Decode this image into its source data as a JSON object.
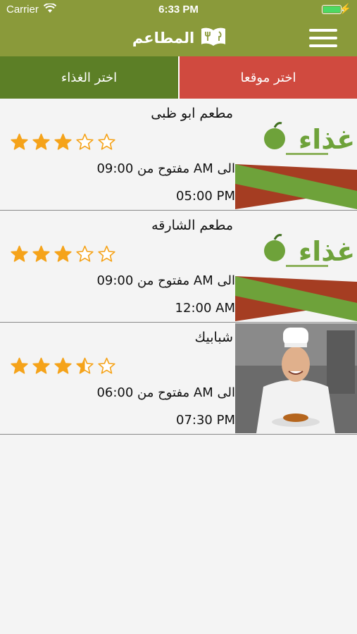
{
  "status_bar": {
    "carrier": "Carrier",
    "time": "6:33 PM"
  },
  "nav": {
    "title": "المطاعم"
  },
  "tabs": {
    "location": "اختر موقعا",
    "food": "اختر الغذاء"
  },
  "restaurants": [
    {
      "name": "مطعم ابو ظبى",
      "rating": 3,
      "hours_line1": "مفتوح من 09:00 AM الى",
      "hours_line2": "05:00 PM",
      "logo_text": "غذاء",
      "thumb": "ghitha-logo"
    },
    {
      "name": "مطعم الشارقه",
      "rating": 3,
      "hours_line1": "مفتوح من 09:00 AM الى",
      "hours_line2": "12:00 AM",
      "logo_text": "غذاء",
      "thumb": "ghitha-logo"
    },
    {
      "name": "شبابيك",
      "rating": 3.5,
      "hours_line1": "مفتوح من 06:00 AM الى",
      "hours_line2": "07:30 PM",
      "thumb": "chef-photo"
    }
  ],
  "colors": {
    "header": "#8a9a3a",
    "tab_food": "#5c7f26",
    "tab_location": "#d04a3f",
    "star": "#f5a31a",
    "logo_green": "#6ea23a",
    "logo_red": "#a53d22"
  }
}
